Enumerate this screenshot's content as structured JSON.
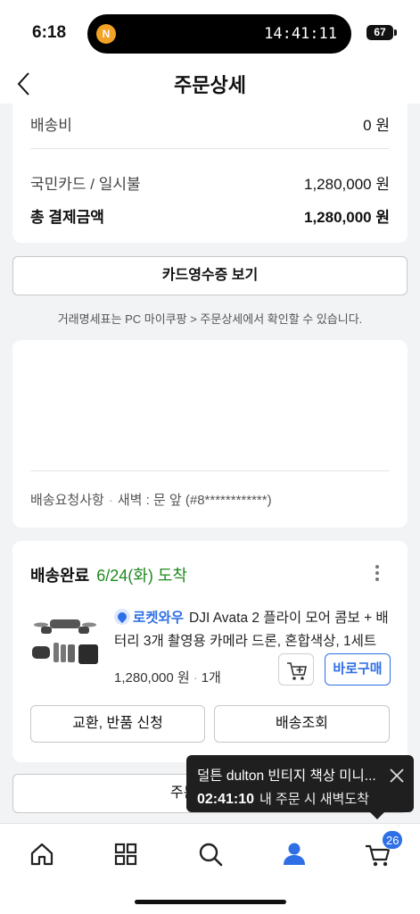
{
  "status_bar": {
    "time": "6:18",
    "island_badge": "N",
    "timer": "14:41:11",
    "battery": "67"
  },
  "header": {
    "title": "주문상세"
  },
  "payment": {
    "shipping_label": "배송비",
    "shipping_value": "0 원",
    "card_label": "국민카드 / 일시불",
    "card_value": "1,280,000 원",
    "total_label": "총 결제금액",
    "total_value": "1,280,000 원"
  },
  "receipt_button": "카드영수증 보기",
  "notice": "거래명세표는 PC 마이쿠팡 > 주문상세에서 확인할 수 있습니다.",
  "address": {
    "request_label": "배송요청사항",
    "request_type": "새벽 : 문 앞",
    "request_code": "(#8************)"
  },
  "order": {
    "status": "배송완료",
    "date": "6/24(화) 도착",
    "rocket_label": "로켓와우",
    "product_name": "DJI Avata 2 플라이 모어 콤보 + 배터리 3개 촬영용 카메라 드론, 혼합색상, 1세트",
    "price": "1,280,000 원",
    "quantity": "1개",
    "buy_now": "바로구매",
    "exchange_button": "교환, 반품 신청",
    "track_button": "배송조회"
  },
  "partial_button": "주문",
  "toast": {
    "title": "덜튼 dulton 빈티지 책상 미니...",
    "countdown": "02:41:10",
    "message": "내 주문 시 새벽도착"
  },
  "tabbar": {
    "cart_badge": "26"
  },
  "colors": {
    "accent": "#2f6fe5",
    "arrival_green": "#1f8a1f"
  }
}
